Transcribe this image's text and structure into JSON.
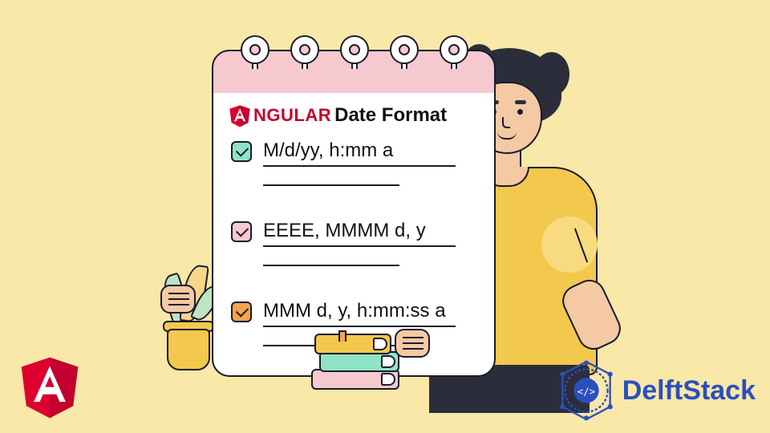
{
  "title": {
    "brand": "NGULAR",
    "rest": "Date Format"
  },
  "items": [
    {
      "format": "M/d/yy, h:mm a",
      "checkColor": "teal"
    },
    {
      "format": "EEEE, MMMM d, y",
      "checkColor": "pink"
    },
    {
      "format": "MMM d, y, h:mm:ss a",
      "checkColor": "orange"
    }
  ],
  "logos": {
    "angular_letter": "A",
    "delft_brand": "DelftStack"
  }
}
